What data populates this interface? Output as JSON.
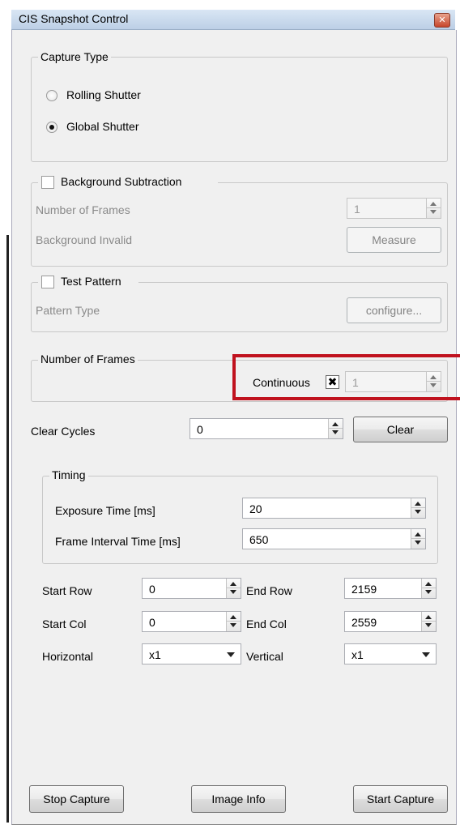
{
  "window": {
    "title": "CIS Snapshot Control"
  },
  "capture_type": {
    "legend": "Capture Type",
    "options": [
      {
        "label": "Rolling Shutter",
        "selected": false
      },
      {
        "label": "Global Shutter",
        "selected": true
      }
    ]
  },
  "background_subtraction": {
    "legend": "Background Subtraction",
    "checked": false,
    "frames_label": "Number of Frames",
    "frames_value": "1",
    "status_label": "Background Invalid",
    "measure_label": "Measure"
  },
  "test_pattern": {
    "legend": "Test Pattern",
    "checked": false,
    "type_label": "Pattern Type",
    "configure_label": "configure..."
  },
  "number_of_frames": {
    "legend": "Number of Frames",
    "continuous_label": "Continuous",
    "continuous_checked": true,
    "value": "1"
  },
  "clear_cycles": {
    "label": "Clear Cycles",
    "value": "0",
    "clear_label": "Clear"
  },
  "timing": {
    "legend": "Timing",
    "exposure_label": "Exposure Time [ms]",
    "exposure_value": "20",
    "interval_label": "Frame Interval Time [ms]",
    "interval_value": "650"
  },
  "region": {
    "start_row_label": "Start Row",
    "start_row_value": "0",
    "end_row_label": "End Row",
    "end_row_value": "2159",
    "start_col_label": "Start Col",
    "start_col_value": "0",
    "end_col_label": "End Col",
    "end_col_value": "2559",
    "horizontal_label": "Horizontal",
    "horizontal_value": "x1",
    "vertical_label": "Vertical",
    "vertical_value": "x1"
  },
  "footer": {
    "stop_label": "Stop Capture",
    "info_label": "Image Info",
    "start_label": "Start Capture"
  },
  "colors": {
    "highlight": "#c0121e",
    "titlebar": "#c8d8ec",
    "window_bg": "#f0f0f0"
  }
}
